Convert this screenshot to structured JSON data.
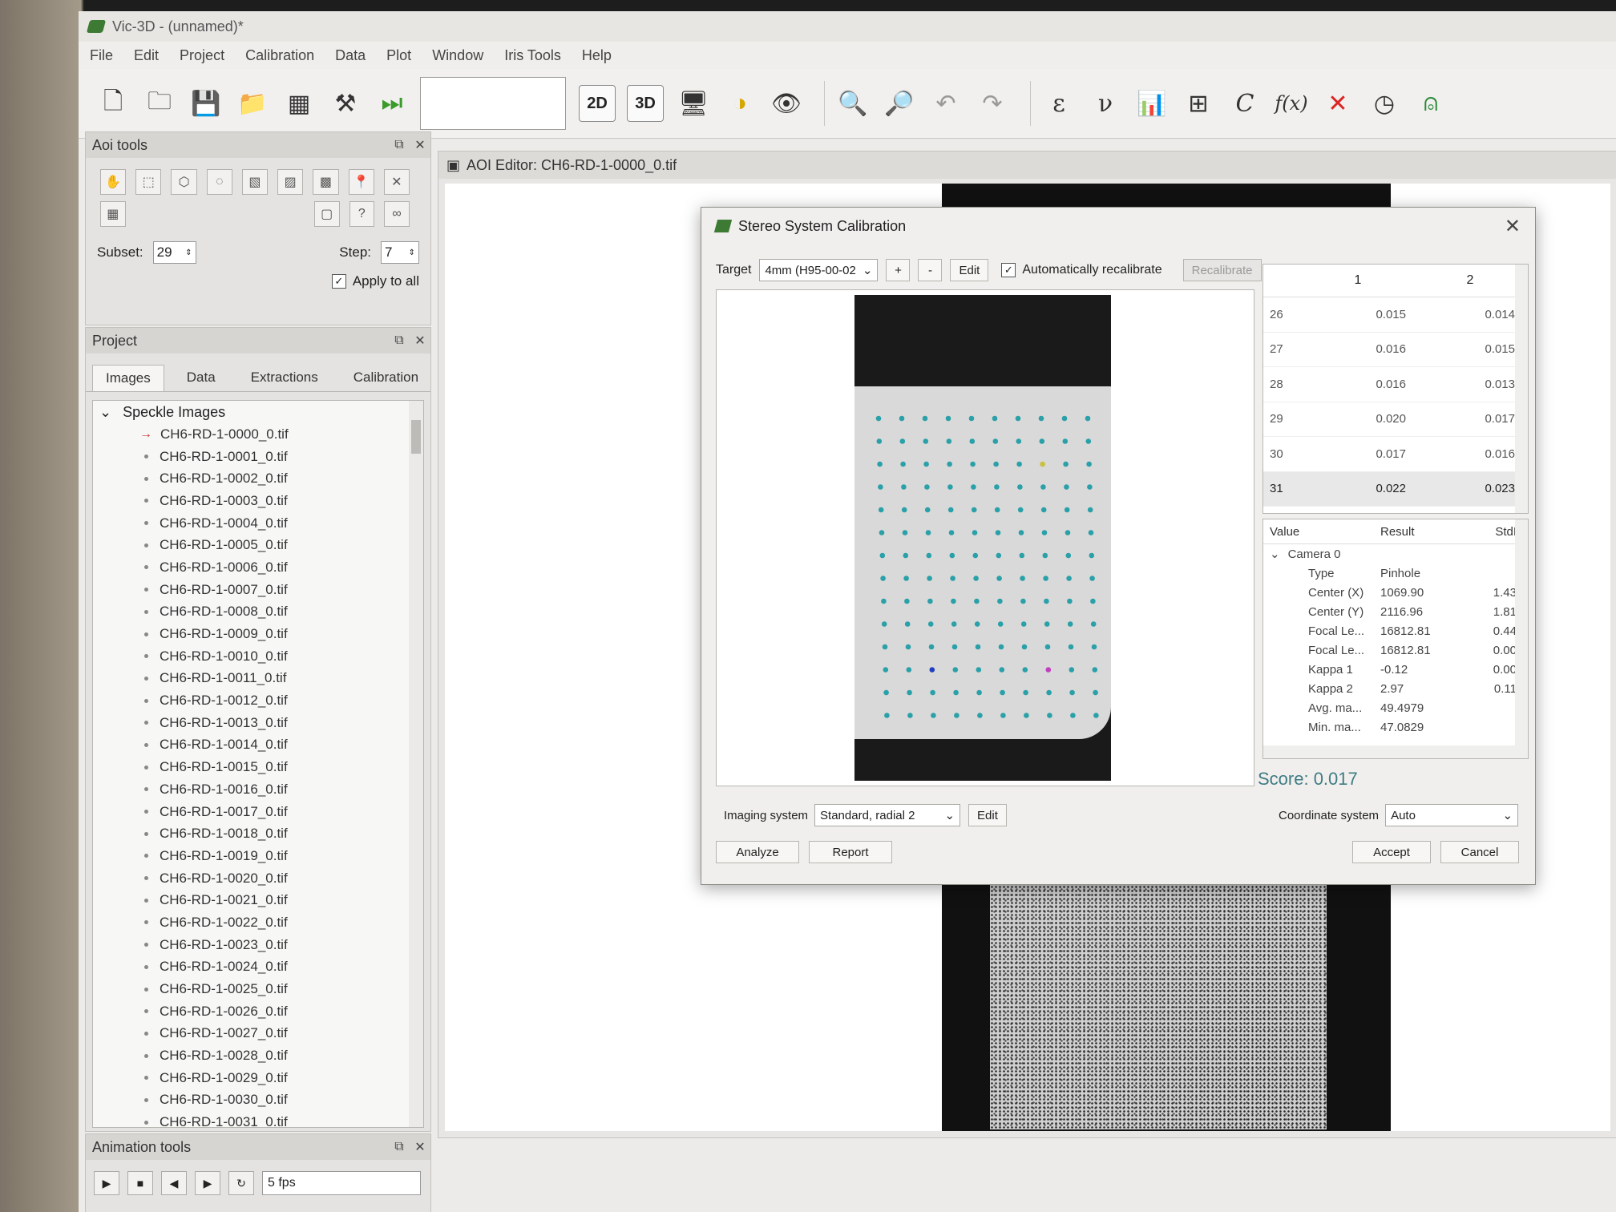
{
  "window": {
    "title": "Vic-3D - (unnamed)*"
  },
  "menu": [
    "File",
    "Edit",
    "Project",
    "Calibration",
    "Data",
    "Plot",
    "Window",
    "Iris Tools",
    "Help"
  ],
  "toolbar": {
    "btn_2d": "2D",
    "btn_3d": "3D",
    "epsilon": "ε",
    "nu": "ν",
    "c": "C",
    "fx": "f(x)"
  },
  "aoi_tools": {
    "title": "Aoi tools",
    "subset_label": "Subset:",
    "subset_value": "29",
    "step_label": "Step:",
    "step_value": "7",
    "apply_all": "Apply to all"
  },
  "project": {
    "title": "Project",
    "tabs": [
      "Images",
      "Data",
      "Extractions",
      "Calibration"
    ],
    "tree_root": "Speckle Images",
    "images": [
      "CH6-RD-1-0000_0.tif",
      "CH6-RD-1-0001_0.tif",
      "CH6-RD-1-0002_0.tif",
      "CH6-RD-1-0003_0.tif",
      "CH6-RD-1-0004_0.tif",
      "CH6-RD-1-0005_0.tif",
      "CH6-RD-1-0006_0.tif",
      "CH6-RD-1-0007_0.tif",
      "CH6-RD-1-0008_0.tif",
      "CH6-RD-1-0009_0.tif",
      "CH6-RD-1-0010_0.tif",
      "CH6-RD-1-0011_0.tif",
      "CH6-RD-1-0012_0.tif",
      "CH6-RD-1-0013_0.tif",
      "CH6-RD-1-0014_0.tif",
      "CH6-RD-1-0015_0.tif",
      "CH6-RD-1-0016_0.tif",
      "CH6-RD-1-0017_0.tif",
      "CH6-RD-1-0018_0.tif",
      "CH6-RD-1-0019_0.tif",
      "CH6-RD-1-0020_0.tif",
      "CH6-RD-1-0021_0.tif",
      "CH6-RD-1-0022_0.tif",
      "CH6-RD-1-0023_0.tif",
      "CH6-RD-1-0024_0.tif",
      "CH6-RD-1-0025_0.tif",
      "CH6-RD-1-0026_0.tif",
      "CH6-RD-1-0027_0.tif",
      "CH6-RD-1-0028_0.tif",
      "CH6-RD-1-0029_0.tif",
      "CH6-RD-1-0030_0.tif",
      "CH6-RD-1-0031_0.tif"
    ]
  },
  "animation_tools": {
    "title": "Animation tools",
    "fps": "5 fps"
  },
  "editor": {
    "title": "AOI Editor: CH6-RD-1-0000_0.tif"
  },
  "dialog": {
    "title": "Stereo System Calibration",
    "target_label": "Target",
    "target_value": "4mm (H95-00-02",
    "plus": "+",
    "minus": "-",
    "edit": "Edit",
    "auto_recal": "Automatically recalibrate",
    "recalibrate": "Recalibrate",
    "grid_cols": [
      "1",
      "2"
    ],
    "grid_rows": [
      {
        "i": "26",
        "a": "0.015",
        "b": "0.014"
      },
      {
        "i": "27",
        "a": "0.016",
        "b": "0.015"
      },
      {
        "i": "28",
        "a": "0.016",
        "b": "0.013"
      },
      {
        "i": "29",
        "a": "0.020",
        "b": "0.017"
      },
      {
        "i": "30",
        "a": "0.017",
        "b": "0.016"
      },
      {
        "i": "31",
        "a": "0.022",
        "b": "0.023"
      }
    ],
    "result_headers": [
      "Value",
      "Result",
      "StdI"
    ],
    "camera": "Camera 0",
    "results": [
      {
        "k": "Type",
        "v": "Pinhole",
        "s": ""
      },
      {
        "k": "Center (X)",
        "v": "1069.90",
        "s": "1.43"
      },
      {
        "k": "Center (Y)",
        "v": "2116.96",
        "s": "1.81"
      },
      {
        "k": "Focal Le...",
        "v": "16812.81",
        "s": "0.44"
      },
      {
        "k": "Focal Le...",
        "v": "16812.81",
        "s": "0.00"
      },
      {
        "k": "Kappa 1",
        "v": "-0.12",
        "s": "0.00"
      },
      {
        "k": "Kappa 2",
        "v": "2.97",
        "s": "0.11"
      },
      {
        "k": "Avg. ma...",
        "v": "49.4979",
        "s": ""
      },
      {
        "k": "Min. ma...",
        "v": "47.0829",
        "s": ""
      }
    ],
    "score": "Score: 0.017",
    "imaging_label": "Imaging system",
    "imaging_value": "Standard, radial 2",
    "coord_label": "Coordinate system",
    "coord_value": "Auto",
    "analyze": "Analyze",
    "report": "Report",
    "accept": "Accept",
    "cancel": "Cancel"
  }
}
